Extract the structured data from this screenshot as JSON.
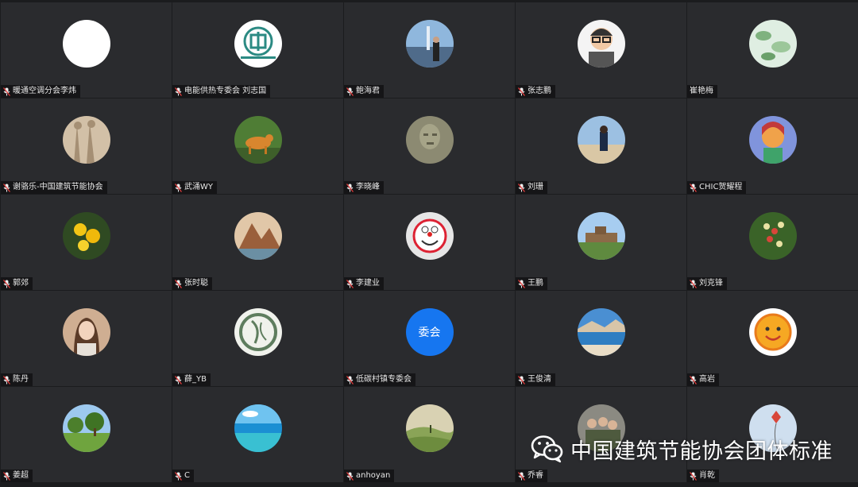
{
  "participants": [
    {
      "name": "暖通空调分会李炜",
      "mic": true,
      "avatar": "blank-white-avatar",
      "bg": "#ffffff"
    },
    {
      "name": "电能供热专委会  刘志国",
      "mic": true,
      "avatar": "association-logo-avatar",
      "bg": "#ffffff"
    },
    {
      "name": "鲍海君",
      "mic": true,
      "avatar": "person-fountain-photo-avatar",
      "bg": "#7fa6c9"
    },
    {
      "name": "张志鹏",
      "mic": true,
      "avatar": "cartoon-man-glasses-avatar",
      "bg": "#f2f2f2"
    },
    {
      "name": "崔艳梅",
      "mic": false,
      "avatar": "green-leaves-photo-avatar",
      "bg": "#cfe3d2"
    },
    {
      "name": "谢骆乐-中国建筑节能协会",
      "mic": true,
      "avatar": "shadows-photo-avatar",
      "bg": "#cbb9a2"
    },
    {
      "name": "武涌WY",
      "mic": true,
      "avatar": "deer-painting-avatar",
      "bg": "#5d8a3b"
    },
    {
      "name": "李晓峰",
      "mic": true,
      "avatar": "stone-carving-avatar",
      "bg": "#8b8a72"
    },
    {
      "name": "刘珊",
      "mic": true,
      "avatar": "person-beach-photo-avatar",
      "bg": "#8fb3d6"
    },
    {
      "name": "CHIC贺耀程",
      "mic": true,
      "avatar": "colorful-portrait-avatar",
      "bg": "#7d8fd8"
    },
    {
      "name": "郭郊",
      "mic": true,
      "avatar": "yellow-flowers-avatar",
      "bg": "#3c5a2a"
    },
    {
      "name": "张时聪",
      "mic": true,
      "avatar": "mountain-painting-avatar",
      "bg": "#b98a6a"
    },
    {
      "name": "李建业",
      "mic": true,
      "avatar": "doraemon-avatar",
      "bg": "#e9e9e9"
    },
    {
      "name": "王鹏",
      "mic": true,
      "avatar": "great-wall-photo-avatar",
      "bg": "#9dc3ea"
    },
    {
      "name": "刘克锋",
      "mic": true,
      "avatar": "flower-cluster-avatar",
      "bg": "#3e6a2c"
    },
    {
      "name": "陈丹",
      "mic": true,
      "avatar": "woman-portrait-avatar",
      "bg": "#c7a58c"
    },
    {
      "name": "薛_YB",
      "mic": true,
      "avatar": "ink-drawing-avatar",
      "bg": "#eef0ea"
    },
    {
      "name": "低碳村镇专委会",
      "mic": true,
      "avatar": "text-avatar",
      "avatar_text": "委会",
      "bg": "#1676f0"
    },
    {
      "name": "王俊清",
      "mic": true,
      "avatar": "lake-landscape-avatar",
      "bg": "#3f86c9"
    },
    {
      "name": "高岩",
      "mic": true,
      "avatar": "smiley-face-avatar",
      "bg": "#ffffff"
    },
    {
      "name": "姜超",
      "mic": true,
      "avatar": "park-trees-avatar",
      "bg": "#76a34a"
    },
    {
      "name": "C",
      "mic": true,
      "avatar": "ocean-photo-avatar",
      "bg": "#34a6d9"
    },
    {
      "name": "anhoyan",
      "mic": true,
      "avatar": "countryside-landscape-avatar",
      "bg": "#9db26a"
    },
    {
      "name": "乔睿",
      "mic": true,
      "avatar": "people-group-photo-avatar",
      "bg": "#8c8a80"
    },
    {
      "name": "肖乾",
      "mic": true,
      "avatar": "kite-sky-avatar",
      "bg": "#d4e2ef"
    }
  ],
  "watermark": {
    "icon": "wechat-icon",
    "text": "中国建筑节能协会团体标准"
  },
  "colors": {
    "tile_bg": "#2a2b2e",
    "text_avatar_blue": "#1676f0"
  }
}
